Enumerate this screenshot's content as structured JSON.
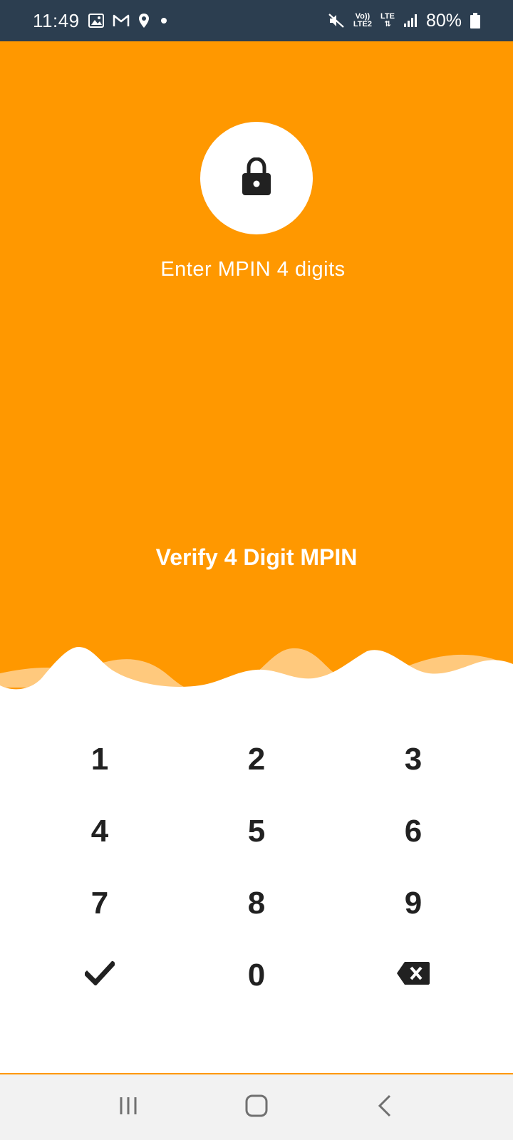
{
  "status_bar": {
    "time": "11:49",
    "battery": "80%",
    "network_top": "Vo))",
    "network_bottom": "LTE2",
    "lte_label": "LTE",
    "icons": [
      "gallery-icon",
      "gmail-icon",
      "location-icon",
      "dot-icon",
      "mute-icon",
      "volte-icon",
      "lte-icon",
      "signal-icon",
      "battery-icon"
    ]
  },
  "header": {
    "lock_icon": "lock-icon",
    "prompt": "Enter MPIN 4 digits",
    "title": "Verify 4 Digit MPIN",
    "accent_color": "#ff9800"
  },
  "keypad": {
    "keys": [
      "1",
      "2",
      "3",
      "4",
      "5",
      "6",
      "7",
      "8",
      "9",
      "",
      "0",
      ""
    ],
    "confirm_icon": "check-icon",
    "delete_icon": "backspace-icon"
  },
  "nav_bar": {
    "buttons": [
      "recents-icon",
      "home-icon",
      "back-icon"
    ]
  }
}
